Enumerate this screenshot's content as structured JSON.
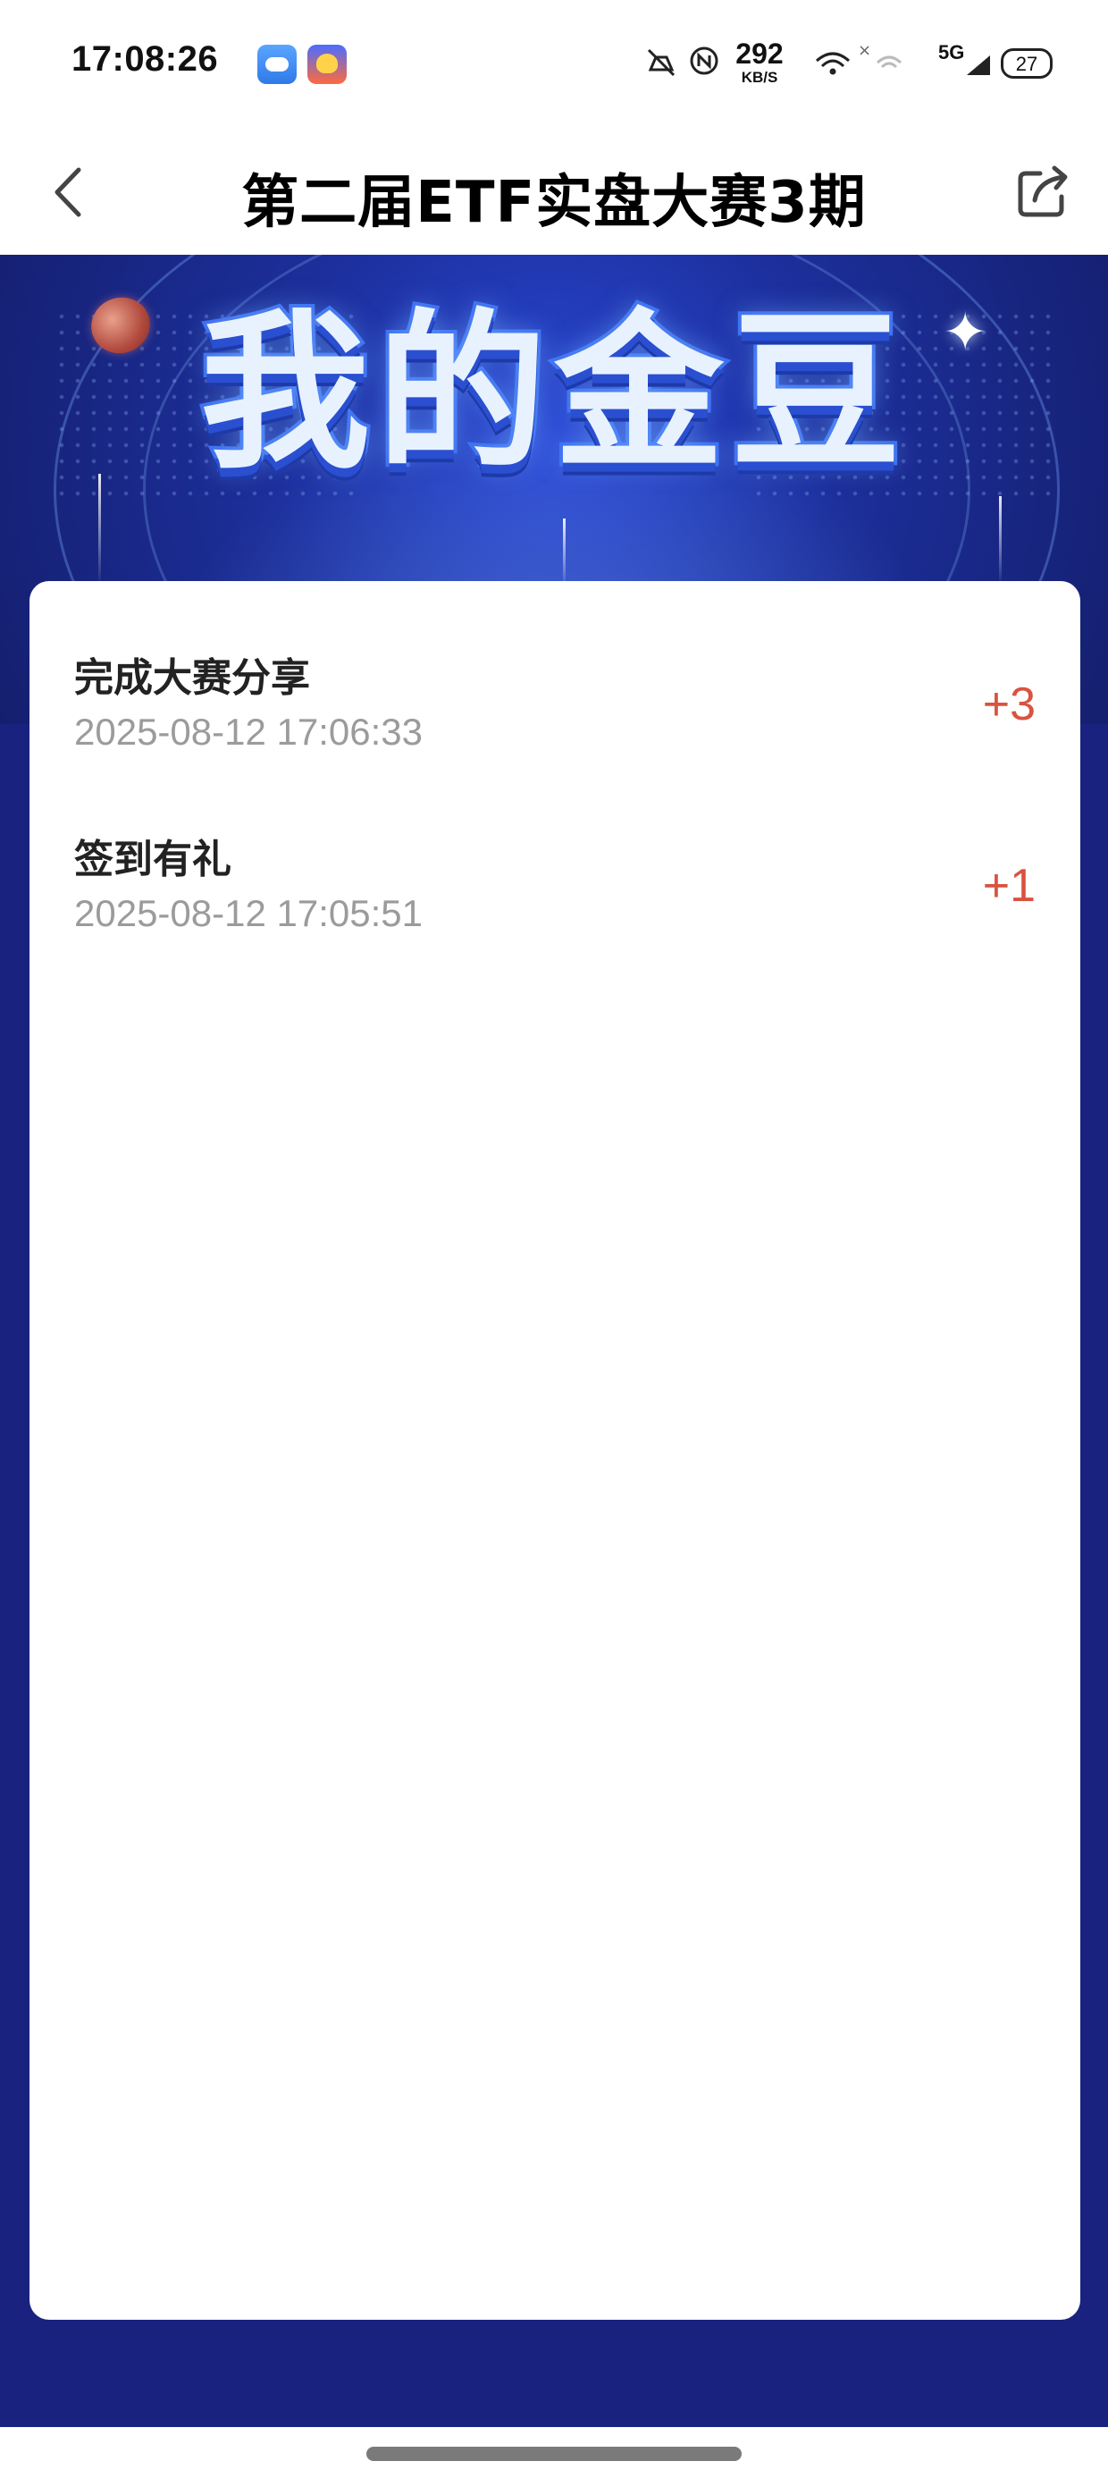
{
  "status_bar": {
    "time": "17:08:26",
    "net_speed_value": "292",
    "net_speed_unit": "KB/S",
    "network_type": "5G",
    "battery_level": "27",
    "icons": [
      "weather-app-icon",
      "game-app-icon",
      "mute-icon",
      "nfc-icon",
      "wifi-icon",
      "signal-icon",
      "battery-icon"
    ]
  },
  "nav": {
    "title": "第二届ETF实盘大赛3期",
    "back_icon": "chevron-left-icon",
    "share_icon": "share-icon"
  },
  "hero": {
    "title": "我的金豆"
  },
  "records": [
    {
      "title": "完成大赛分享",
      "time": "2025-08-12 17:06:33",
      "points": "+3"
    },
    {
      "title": "签到有礼",
      "time": "2025-08-12 17:05:51",
      "points": "+1"
    }
  ],
  "colors": {
    "points": "#d9533f",
    "page_background": "#1a2280",
    "hero_title_outline": "#3a6cf0"
  }
}
